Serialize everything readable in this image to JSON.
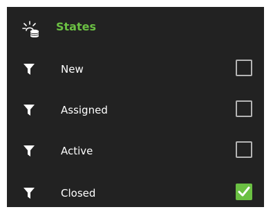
{
  "header": {
    "title": "States",
    "icon": "database-settings-icon"
  },
  "states": [
    {
      "label": "New",
      "checked": false
    },
    {
      "label": "Assigned",
      "checked": false
    },
    {
      "label": "Active",
      "checked": false
    },
    {
      "label": "Closed",
      "checked": true
    }
  ],
  "colors": {
    "panel_background": "#222222",
    "accent": "#6bc043",
    "checkbox_border": "#b5b5b5",
    "text": "#ffffff"
  }
}
